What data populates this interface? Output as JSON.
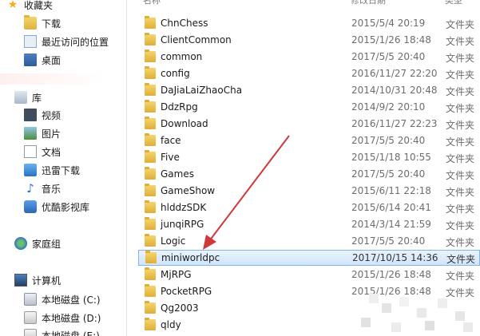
{
  "nav": {
    "favorites": "收藏夹",
    "downloads": "下载",
    "recent": "最近访问的位置",
    "desktop": "桌面",
    "libraries": "库",
    "videos": "视频",
    "pictures": "图片",
    "documents": "文档",
    "thunder": "迅雷下载",
    "music": "音乐",
    "youku": "优酷影视库",
    "homegroup": "家庭组",
    "computer": "计算机",
    "disk_c": "本地磁盘 (C:)",
    "disk_d": "本地磁盘 (D:)",
    "disk_e": "本地磁盘 (E:)"
  },
  "header": {
    "name": "名称",
    "date": "修改日期",
    "type": "类型"
  },
  "files": [
    {
      "name": "ChnChess",
      "date": "2015/5/4 20:19",
      "type": "文件夹"
    },
    {
      "name": "ClientCommon",
      "date": "2015/1/26 18:48",
      "type": "文件夹"
    },
    {
      "name": "common",
      "date": "2017/5/5 20:40",
      "type": "文件夹"
    },
    {
      "name": "config",
      "date": "2016/11/27 22:20",
      "type": "文件夹"
    },
    {
      "name": "DaJiaLaiZhaoCha",
      "date": "2014/10/31 20:48",
      "type": "文件夹"
    },
    {
      "name": "DdzRpg",
      "date": "2014/9/2 20:10",
      "type": "文件夹"
    },
    {
      "name": "Download",
      "date": "2016/11/27 22:23",
      "type": "文件夹"
    },
    {
      "name": "face",
      "date": "2017/5/5 20:40",
      "type": "文件夹"
    },
    {
      "name": "Five",
      "date": "2015/1/18 10:55",
      "type": "文件夹"
    },
    {
      "name": "Games",
      "date": "2017/5/5 20:40",
      "type": "文件夹"
    },
    {
      "name": "GameShow",
      "date": "2015/6/11 22:18",
      "type": "文件夹"
    },
    {
      "name": "hlddzSDK",
      "date": "2015/6/14 20:41",
      "type": "文件夹"
    },
    {
      "name": "junqiRPG",
      "date": "2014/3/14 21:59",
      "type": "文件夹"
    },
    {
      "name": "Logic",
      "date": "2017/5/5 20:40",
      "type": "文件夹"
    },
    {
      "name": "miniworldpc",
      "date": "2017/10/15 14:36",
      "type": "文件夹"
    },
    {
      "name": "MjRPG",
      "date": "2015/1/26 18:48",
      "type": "文件夹"
    },
    {
      "name": "PocketRPG",
      "date": "2015/1/26 18:48",
      "type": "文件夹"
    },
    {
      "name": "Qg2003",
      "date": "",
      "type": ""
    },
    {
      "name": "qldy",
      "date": "",
      "type": ""
    }
  ],
  "selected_file": "miniworldpc",
  "colors": {
    "selection_bg": "#cfe5fc",
    "selection_border": "#84b5e6",
    "folder": "#e8c14f",
    "annotation_arrow": "#d0393a"
  }
}
